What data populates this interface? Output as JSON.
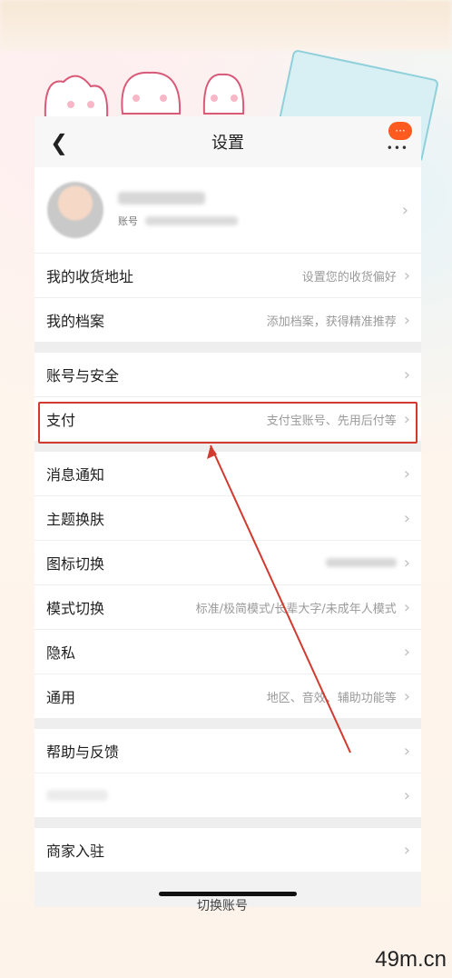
{
  "nav": {
    "title": "设置",
    "back_icon": "chevron-left-icon",
    "more_icon": "more-dots-icon"
  },
  "profile": {
    "account_prefix": "账号"
  },
  "section_1": [
    {
      "label": "我的收货地址",
      "value": "设置您的收货偏好"
    },
    {
      "label": "我的档案",
      "value": "添加档案，获得精准推荐"
    }
  ],
  "section_2": [
    {
      "label": "账号与安全",
      "value": ""
    },
    {
      "label": "支付",
      "value": "支付宝账号、先用后付等"
    }
  ],
  "section_3": [
    {
      "label": "消息通知",
      "value": ""
    },
    {
      "label": "主题换肤",
      "value": ""
    },
    {
      "label": "图标切换",
      "value": ""
    },
    {
      "label": "模式切换",
      "value": "标准/极简模式/长辈大字/未成年人模式"
    },
    {
      "label": "隐私",
      "value": ""
    },
    {
      "label": "通用",
      "value": "地区、音效、辅助功能等"
    }
  ],
  "section_4": [
    {
      "label": "帮助与反馈",
      "value": ""
    },
    {
      "label": "",
      "value": ""
    }
  ],
  "section_5": [
    {
      "label": "商家入驻",
      "value": ""
    }
  ],
  "bottom_text": "切换账号",
  "watermark": "49m.cn",
  "colors": {
    "highlight": "#d23a2f",
    "more_badge": "#ff5a1f",
    "arrow": "#d23a2f"
  }
}
